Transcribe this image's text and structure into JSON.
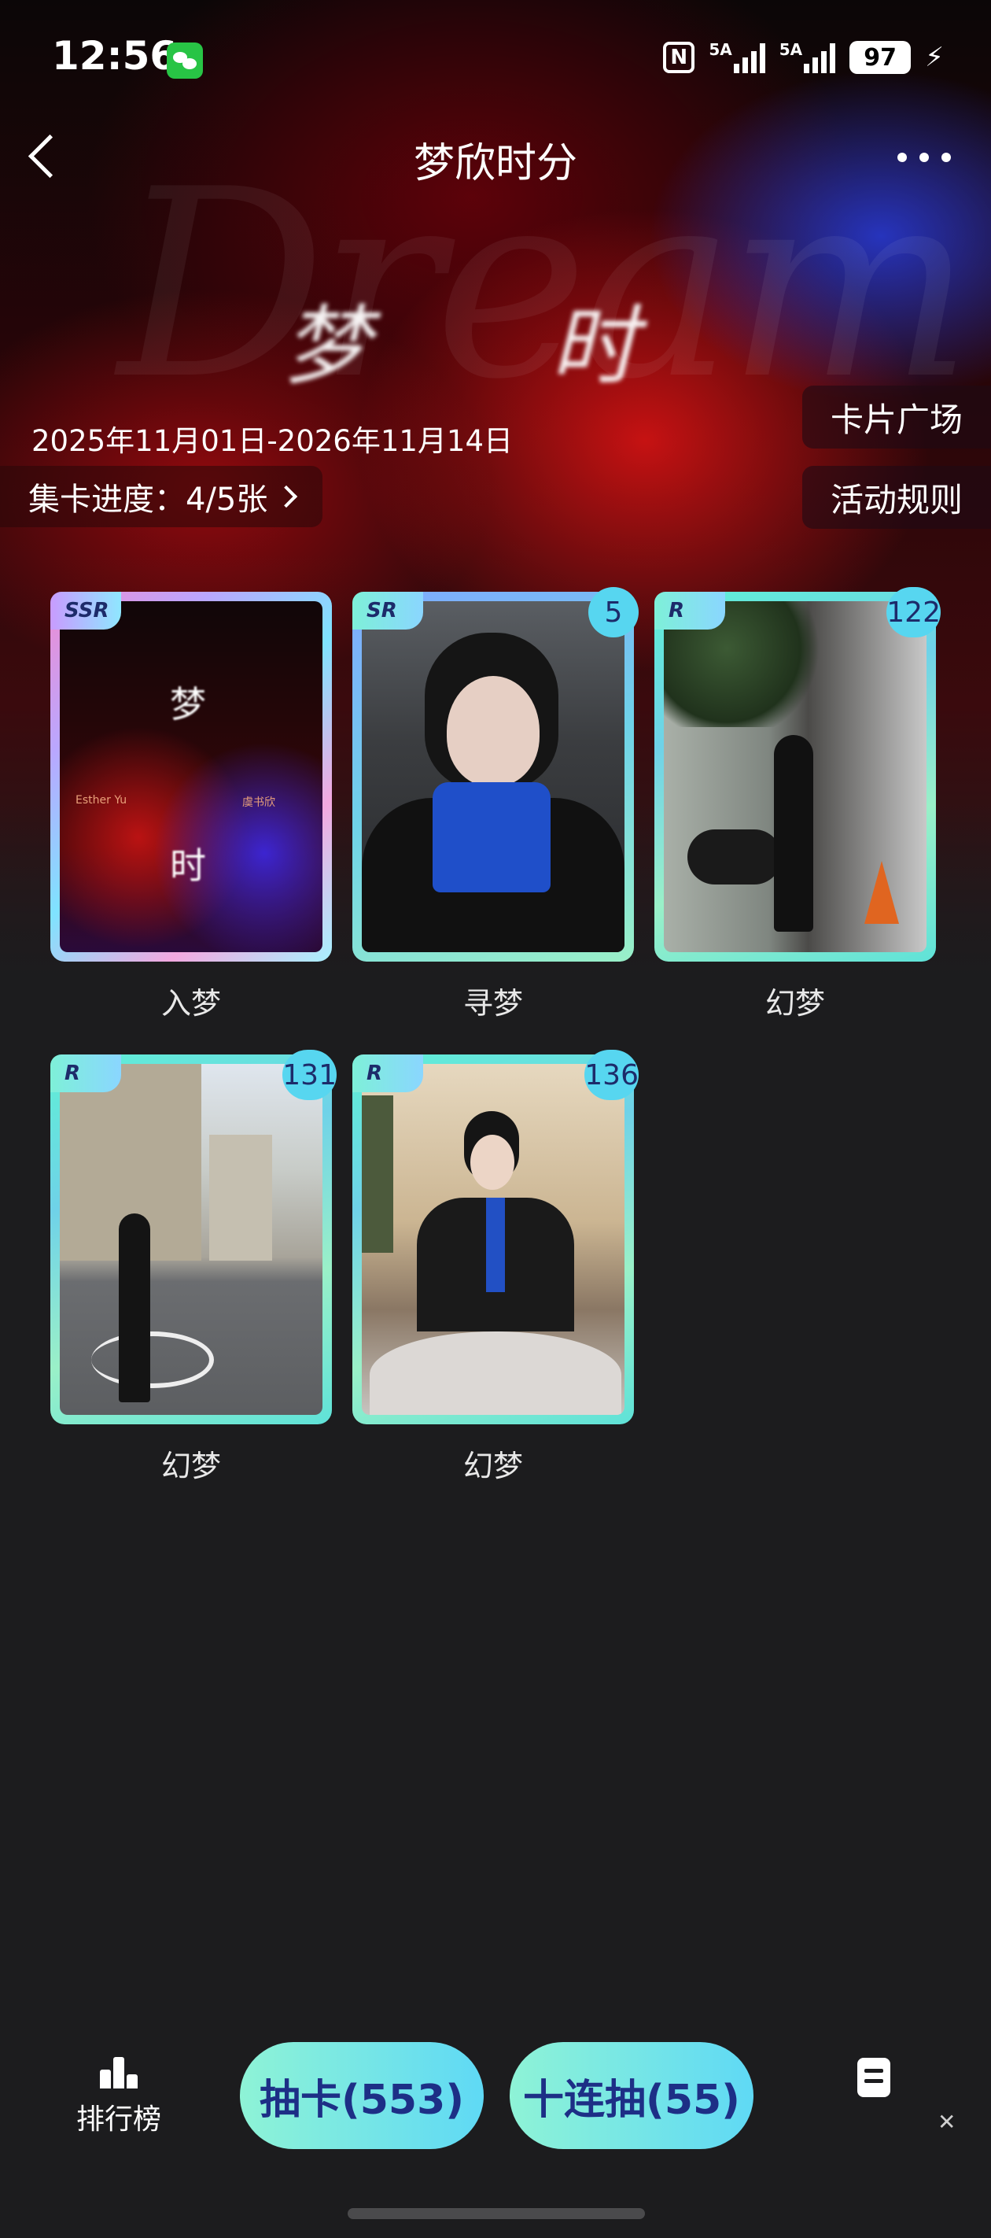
{
  "status_bar": {
    "time": "12:56",
    "network1": "5A",
    "network2": "5A",
    "battery": "97"
  },
  "header": {
    "title": "梦欣时分"
  },
  "hero": {
    "script_text": "Dream",
    "logo_left": "梦",
    "logo_right": "时"
  },
  "event": {
    "date_range": "2025年11月01日-2026年11月14日",
    "progress_label": "集卡进度：4/5张",
    "plaza_button": "卡片广场",
    "rules_button": "活动规则"
  },
  "cards": [
    {
      "rarity": "SSR",
      "count": "",
      "name": "入梦",
      "art_artist": "Esther Yu",
      "art_artist_cn": "虞书欣"
    },
    {
      "rarity": "SR",
      "count": "5",
      "name": "寻梦"
    },
    {
      "rarity": "R",
      "count": "122",
      "name": "幻梦"
    },
    {
      "rarity": "R",
      "count": "131",
      "name": "幻梦"
    },
    {
      "rarity": "R",
      "count": "136",
      "name": "幻梦"
    }
  ],
  "bottom_bar": {
    "ranking_label": "排行榜",
    "draw_button": "抽卡(553)",
    "ten_draw_button": "十连抽(55)"
  },
  "colors": {
    "accent_gradient_start": "#8ef3d6",
    "accent_gradient_end": "#5fd9f5",
    "button_text": "#1d2f86",
    "background": "#1c1c1e"
  }
}
